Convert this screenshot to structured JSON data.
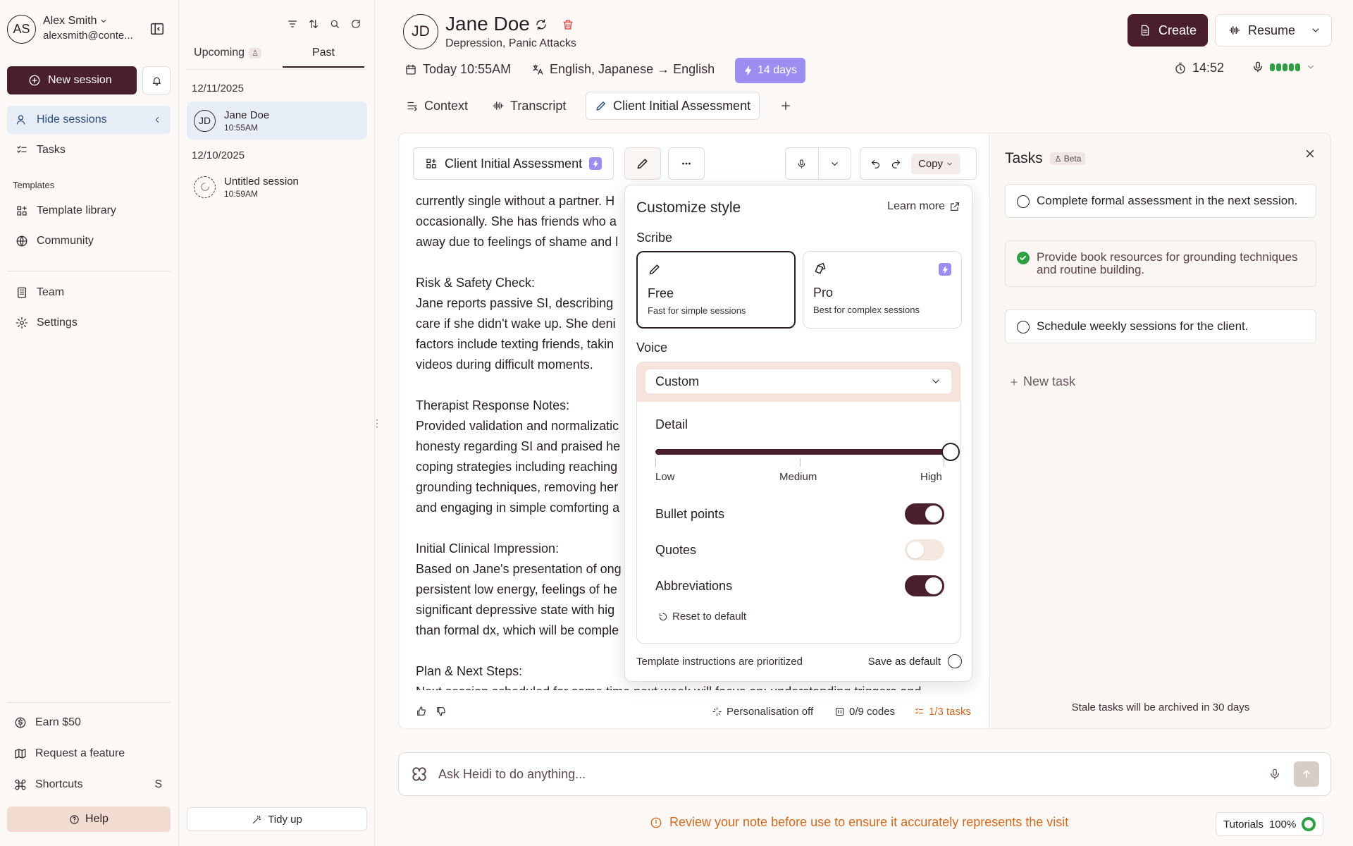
{
  "user": {
    "initials": "AS",
    "name": "Alex Smith",
    "email": "alexsmith@conte..."
  },
  "sidebar": {
    "new_session": "New session",
    "hide_sessions": "Hide sessions",
    "tasks": "Tasks",
    "templates_section": "Templates",
    "template_library": "Template library",
    "community": "Community",
    "team": "Team",
    "settings": "Settings",
    "earn": "Earn $50",
    "request_feature": "Request a feature",
    "shortcuts": "Shortcuts",
    "shortcuts_key": "S",
    "help": "Help"
  },
  "sessions": {
    "tabs": {
      "upcoming": "Upcoming",
      "upcoming_badge": "♙",
      "past": "Past"
    },
    "groups": [
      {
        "date": "12/11/2025",
        "items": [
          {
            "initials": "JD",
            "name": "Jane Doe",
            "time": "10:55AM"
          }
        ]
      },
      {
        "date": "12/10/2025",
        "items": [
          {
            "initials": "",
            "name": "Untitled session",
            "time": "10:59AM"
          }
        ]
      }
    ],
    "tidy_up": "Tidy up"
  },
  "header": {
    "initials": "JD",
    "patient_name": "Jane Doe",
    "tags": "Depression, Panic Attacks",
    "create": "Create",
    "resume": "Resume",
    "date": "Today 10:55AM",
    "languages": "English, Japanese → English",
    "days_badge": "14 days",
    "timer": "14:52",
    "tabs": {
      "context": "Context",
      "transcript": "Transcript",
      "assessment": "Client Initial Assessment"
    }
  },
  "note": {
    "template_name": "Client Initial Assessment",
    "copy": "Copy",
    "paragraphs": [
      "currently single without a partner. H\noccasionally. She has friends who a\naway due to feelings of shame and l",
      "Risk & Safety Check:\nJane reports passive SI, describing\ncare if she didn't wake up. She deni\nfactors include texting friends, takin\nvideos during difficult moments.",
      "Therapist Response Notes:\nProvided validation and normalizatic\nhonesty regarding SI and praised he\ncoping strategies including reaching\ngrounding techniques, removing her\nand engaging in simple comforting a",
      "Initial Clinical Impression:\nBased on Jane's presentation of ong\npersistent low energy, feelings of he\nsignificant depressive state with hig\nthan formal dx, which will be comple",
      "Plan & Next Steps:\nNext session scheduled for same time next week will focus on: understanding triggers and"
    ],
    "footer": {
      "personalisation": "Personalisation off",
      "codes": "0/9 codes",
      "tasks": "1/3 tasks"
    }
  },
  "popover": {
    "title": "Customize style",
    "learn_more": "Learn more",
    "scribe_label": "Scribe",
    "scribe": [
      {
        "name": "Free",
        "desc": "Fast for simple sessions"
      },
      {
        "name": "Pro",
        "desc": "Best for complex sessions"
      }
    ],
    "voice_label": "Voice",
    "voice_value": "Custom",
    "detail_label": "Detail",
    "detail_levels": [
      "Low",
      "Medium",
      "High"
    ],
    "detail_value": "High",
    "toggles": [
      {
        "label": "Bullet points",
        "on": true
      },
      {
        "label": "Quotes",
        "on": false
      },
      {
        "label": "Abbreviations",
        "on": true
      }
    ],
    "reset": "Reset to default",
    "footer_note": "Template instructions are prioritized",
    "save_default": "Save as default"
  },
  "tasks": {
    "title": "Tasks",
    "beta": "Beta",
    "items": [
      {
        "text": "Complete formal assessment in the next session.",
        "done": false
      },
      {
        "text": "Provide book resources for grounding techniques and routine building.",
        "done": true
      },
      {
        "text": "Schedule weekly sessions for the client.",
        "done": false
      }
    ],
    "new_task": "New task",
    "stale_note": "Stale tasks will be archived in 30 days"
  },
  "bottom": {
    "ask_placeholder": "Ask Heidi to do anything...",
    "warning": "Review your note before use to ensure it accurately represents the visit",
    "tutorials": "Tutorials",
    "tutorials_pct": "100%"
  },
  "colors": {
    "brand": "#4a1f2c",
    "accent_purple": "#9b8ef0",
    "success": "#2ea043",
    "warning": "#d2691e"
  }
}
